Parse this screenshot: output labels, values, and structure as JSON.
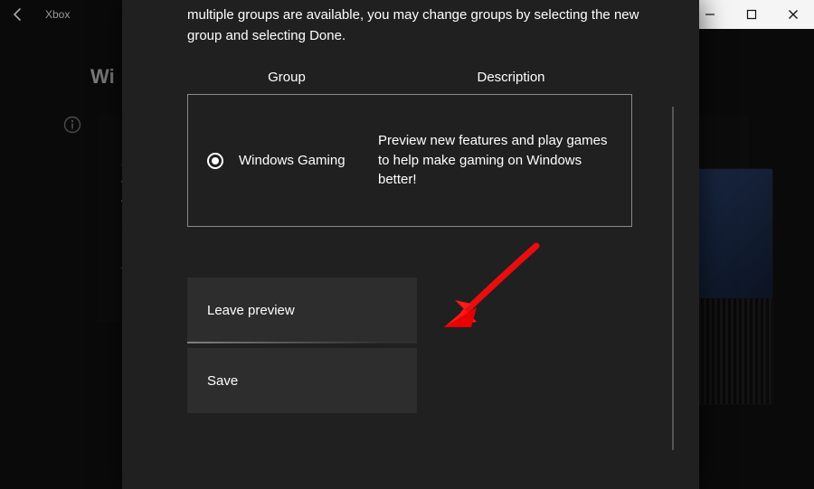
{
  "titlebar": {
    "app": "Xbox"
  },
  "background": {
    "heading": "Wi",
    "line1a": "Ple",
    "line1b": "on",
    "line1c": "ver",
    "line1d": "Wi",
    "line1e": "Ser",
    "line2a": "Tha",
    "line2b": "bet"
  },
  "modal": {
    "intro": "multiple groups are available, you may change groups by selecting the new group and selecting Done.",
    "columns": {
      "group": "Group",
      "description": "Description"
    },
    "item": {
      "name": "Windows Gaming",
      "description": "Preview new features and play games to help make gaming on Windows better!"
    },
    "buttons": {
      "leave": "Leave preview",
      "save": "Save"
    }
  }
}
